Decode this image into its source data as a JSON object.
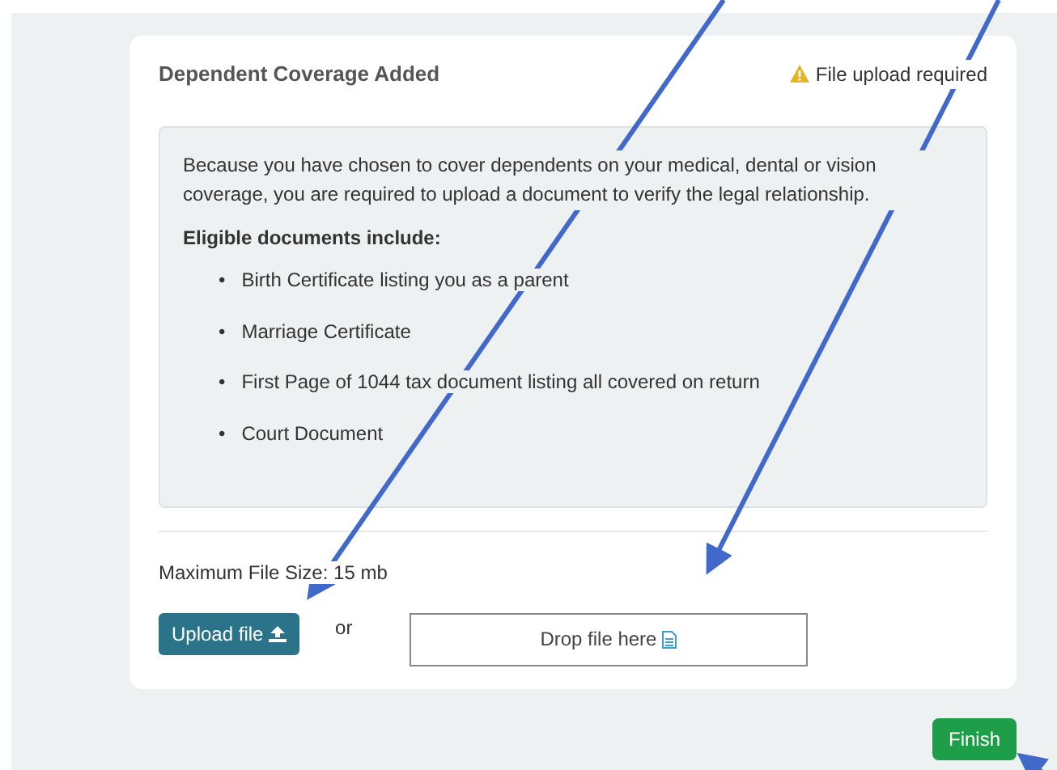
{
  "card": {
    "title": "Dependent Coverage Added",
    "status": "File upload required",
    "notice": {
      "intro": "Because you have chosen to cover dependents on your medical, dental or vision coverage, you are required to upload a document to verify the legal relationship.",
      "list_heading": "Eligible documents include:",
      "bullet": "•",
      "documents": [
        "Birth Certificate listing you as a parent",
        "Marriage Certificate",
        "First Page of 1044 tax document listing all covered on return",
        "Court Document"
      ]
    },
    "max_size": "Maximum File Size: 15 mb",
    "upload_button": "Upload file",
    "separator": "or",
    "drop_zone": "Drop file here"
  },
  "finish_button": "Finish"
}
